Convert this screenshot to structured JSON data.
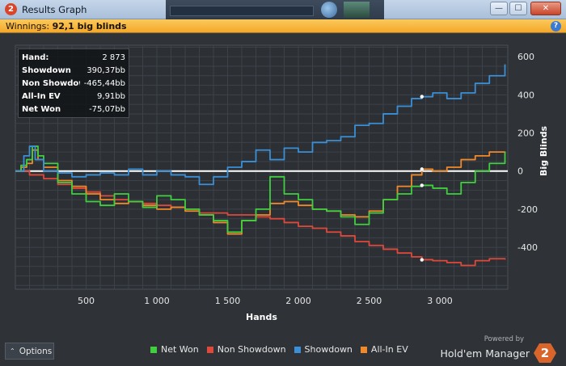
{
  "window": {
    "title": "Results Graph",
    "app_icon": "2",
    "buttons": {
      "min": "—",
      "max": "☐",
      "close": "✕"
    }
  },
  "winnings": {
    "label": "Winnings:",
    "value": "92,1 big blinds"
  },
  "stats": [
    {
      "label": "Hand:",
      "value": "2 873"
    },
    {
      "label": "Showdown",
      "value": "390,37bb"
    },
    {
      "label": "Non Showdown",
      "value": "-465,44bb"
    },
    {
      "label": "All-In EV",
      "value": "9,91bb"
    },
    {
      "label": "Net Won",
      "value": "-75,07bb"
    }
  ],
  "legend": [
    {
      "name": "Net Won",
      "color": "#3fcf3f"
    },
    {
      "name": "Non Showdown",
      "color": "#e0483a"
    },
    {
      "name": "Showdown",
      "color": "#3a8fd6"
    },
    {
      "name": "All-In EV",
      "color": "#f0892a"
    }
  ],
  "options_label": "Options",
  "branding": {
    "powered_by": "Powered by",
    "name": "Hold'em Manager",
    "logo": "2"
  },
  "chart_data": {
    "type": "line",
    "xlabel": "Hands",
    "ylabel": "Big Blinds",
    "xlim": [
      0,
      3480
    ],
    "ylim": [
      -620,
      660
    ],
    "x_ticks": [
      500,
      1000,
      1500,
      2000,
      2500,
      3000
    ],
    "x_tick_labels": [
      "500",
      "1 000",
      "1 500",
      "2 000",
      "2 500",
      "3 000"
    ],
    "y_ticks": [
      -400,
      -200,
      0,
      200,
      400,
      600
    ],
    "y_tick_labels": [
      "-400",
      "-200",
      "0",
      "200",
      "400",
      "600"
    ],
    "zero_line": true,
    "grid": true,
    "series": [
      {
        "name": "Showdown",
        "color": "#3a8fd6",
        "x": [
          0,
          60,
          100,
          140,
          200,
          300,
          400,
          500,
          600,
          700,
          800,
          900,
          1000,
          1100,
          1200,
          1300,
          1400,
          1500,
          1600,
          1700,
          1800,
          1900,
          2000,
          2100,
          2200,
          2300,
          2400,
          2500,
          2600,
          2700,
          2800,
          2873,
          2950,
          3050,
          3150,
          3250,
          3350,
          3460
        ],
        "y": [
          0,
          80,
          130,
          60,
          0,
          -10,
          -30,
          -20,
          -10,
          -20,
          10,
          -20,
          0,
          -20,
          -30,
          -70,
          -30,
          20,
          50,
          110,
          60,
          120,
          100,
          150,
          160,
          180,
          240,
          250,
          300,
          340,
          380,
          390,
          410,
          380,
          410,
          460,
          500,
          560
        ]
      },
      {
        "name": "Net Won",
        "color": "#3fcf3f",
        "x": [
          0,
          40,
          80,
          120,
          160,
          200,
          300,
          400,
          500,
          600,
          700,
          800,
          900,
          1000,
          1100,
          1200,
          1300,
          1400,
          1500,
          1600,
          1700,
          1800,
          1900,
          2000,
          2100,
          2200,
          2300,
          2400,
          2500,
          2600,
          2700,
          2800,
          2873,
          2950,
          3050,
          3150,
          3250,
          3350,
          3460
        ],
        "y": [
          0,
          30,
          60,
          130,
          80,
          40,
          -60,
          -120,
          -160,
          -180,
          -120,
          -160,
          -190,
          -130,
          -150,
          -200,
          -230,
          -260,
          -320,
          -260,
          -200,
          -30,
          -120,
          -150,
          -200,
          -210,
          -240,
          -280,
          -220,
          -150,
          -120,
          -80,
          -75,
          -90,
          -120,
          -60,
          0,
          40,
          100
        ]
      },
      {
        "name": "Non Showdown",
        "color": "#e0483a",
        "x": [
          0,
          100,
          200,
          300,
          400,
          500,
          600,
          700,
          800,
          900,
          1000,
          1100,
          1200,
          1300,
          1400,
          1500,
          1600,
          1700,
          1800,
          1900,
          2000,
          2100,
          2200,
          2300,
          2400,
          2500,
          2600,
          2700,
          2800,
          2873,
          2950,
          3050,
          3150,
          3250,
          3350,
          3460
        ],
        "y": [
          0,
          -20,
          -40,
          -70,
          -90,
          -110,
          -130,
          -150,
          -160,
          -170,
          -180,
          -190,
          -200,
          -220,
          -220,
          -230,
          -230,
          -240,
          -250,
          -270,
          -290,
          -300,
          -320,
          -340,
          -370,
          -390,
          -410,
          -430,
          -450,
          -465,
          -470,
          -480,
          -495,
          -470,
          -460,
          -465
        ]
      },
      {
        "name": "All-In EV",
        "color": "#f0892a",
        "x": [
          0,
          40,
          80,
          120,
          160,
          200,
          300,
          400,
          500,
          600,
          700,
          800,
          900,
          1000,
          1100,
          1200,
          1300,
          1400,
          1500,
          1600,
          1700,
          1800,
          1900,
          2000,
          2100,
          2200,
          2300,
          2400,
          2500,
          2600,
          2700,
          2800,
          2873,
          2950,
          3050,
          3150,
          3250,
          3350,
          3460
        ],
        "y": [
          0,
          20,
          40,
          110,
          60,
          20,
          -50,
          -80,
          -120,
          -150,
          -170,
          -160,
          -180,
          -200,
          -190,
          -210,
          -230,
          -270,
          -330,
          -260,
          -230,
          -170,
          -160,
          -180,
          -200,
          -210,
          -230,
          -240,
          -210,
          -150,
          -80,
          -20,
          10,
          0,
          20,
          60,
          80,
          100,
          90
        ]
      }
    ],
    "markers": [
      {
        "series": "Showdown",
        "x": 2873,
        "y": 390.37
      },
      {
        "series": "Net Won",
        "x": 2873,
        "y": -75.07
      },
      {
        "series": "Non Showdown",
        "x": 2873,
        "y": -465.44
      },
      {
        "series": "All-In EV",
        "x": 2873,
        "y": 9.91
      }
    ]
  }
}
